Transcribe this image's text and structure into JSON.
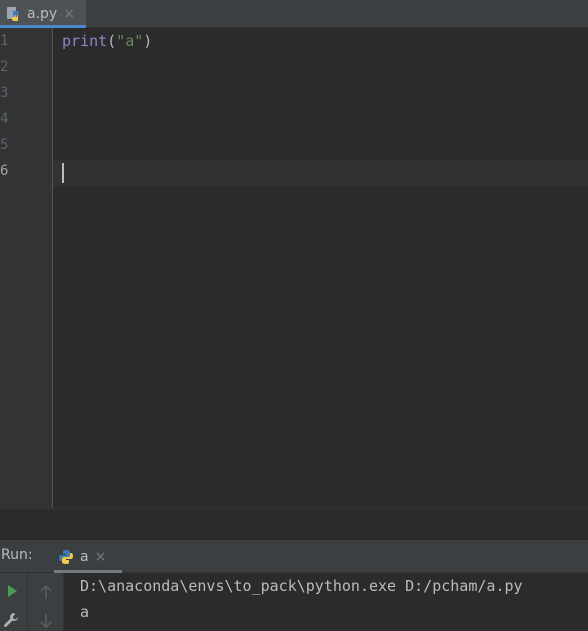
{
  "editor": {
    "tabs": [
      {
        "label": "a.py",
        "icon": "python-file-icon",
        "close_glyph": "×",
        "active": true
      }
    ],
    "line_numbers": [
      "1",
      "2",
      "3",
      "4",
      "5",
      "6"
    ],
    "current_line": "6",
    "code": {
      "line1": {
        "builtin": "print",
        "open_paren": "(",
        "string": "\"a\"",
        "close_paren": ")"
      }
    }
  },
  "run_panel": {
    "title": "Run:",
    "tabs": [
      {
        "label": "a",
        "icon": "python-icon",
        "close_glyph": "×"
      }
    ],
    "toolbar": {
      "run_icon": "play-icon",
      "settings_icon": "wrench-icon",
      "up_icon": "arrow-up-icon",
      "down_icon": "arrow-down-icon"
    },
    "console": {
      "command": "D:\\anaconda\\envs\\to_pack\\python.exe D:/pcham/a.py",
      "output": "a"
    }
  },
  "colors": {
    "background": "#2b2b2b",
    "gutter": "#313335",
    "tab_active_underline": "#4a88c7",
    "builtin": "#8888c6",
    "string": "#6a8759",
    "text": "#a9b7c6",
    "run_green": "#499c54"
  }
}
